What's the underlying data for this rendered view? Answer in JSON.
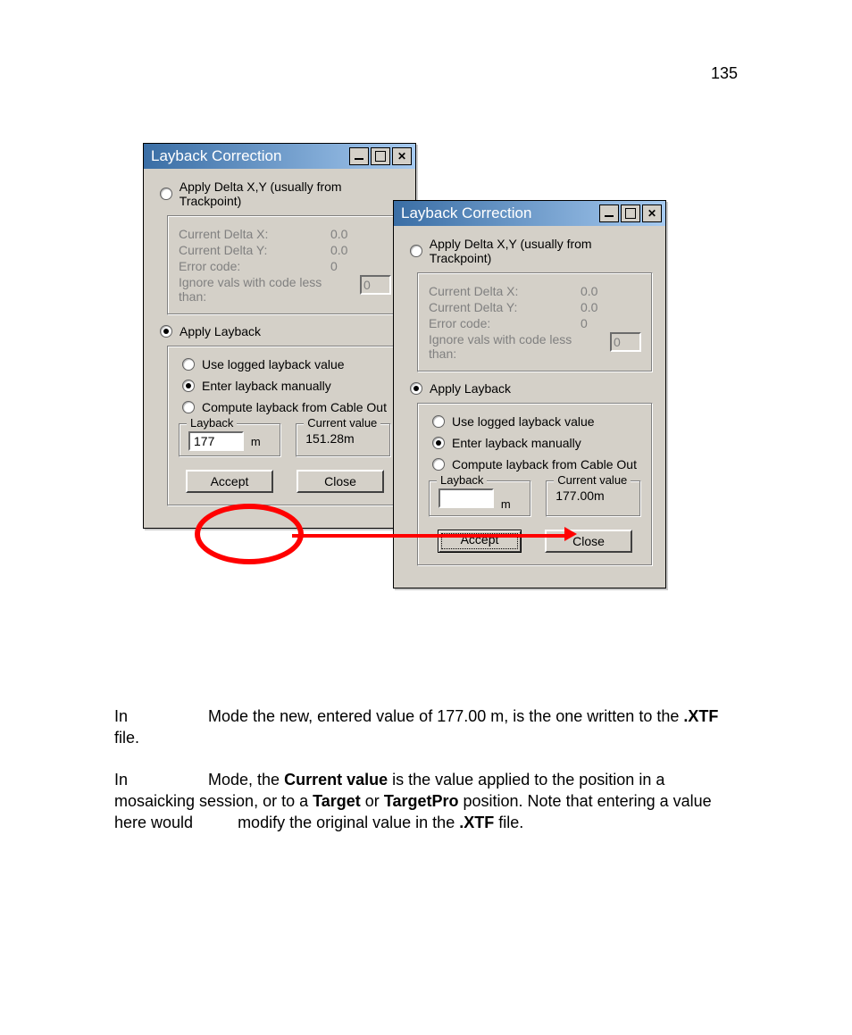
{
  "page_number": "135",
  "dialog_title": "Layback Correction",
  "radio_apply_delta": "Apply Delta X,Y (usually from Trackpoint)",
  "delta_group": {
    "delta_x_label": "Current Delta X:",
    "delta_x_value": "0.0",
    "delta_y_label": "Current Delta Y:",
    "delta_y_value": "0.0",
    "error_label": "Error code:",
    "error_value": "0",
    "ignore_label": "Ignore vals with code less than:",
    "ignore_value": "0"
  },
  "radio_apply_layback": "Apply Layback",
  "layback_options": {
    "use_logged": "Use logged layback value",
    "enter_manually": "Enter layback manually",
    "compute_cable": "Compute layback from Cable Out"
  },
  "layback_fieldset_label": "Layback",
  "current_value_fieldset_label": "Current value",
  "unit": "m",
  "dialog1": {
    "layback_input": "177",
    "current_value": "151.28m"
  },
  "dialog2": {
    "layback_input": "",
    "current_value": "177.00m"
  },
  "buttons": {
    "accept": "Accept",
    "close": "Close"
  },
  "text": {
    "p1a": "In ",
    "p1b": " Mode the new, entered value of 177.00 m, is the one written to the ",
    "p1c": ".XTF",
    "p1d": " file.",
    "p2a": "In ",
    "p2b": " Mode, the ",
    "p2c": "Current value",
    "p2d": " is the value applied to the position in a mosaicking session, or to a ",
    "p2e": "Target",
    "p2f": " or ",
    "p2g": "TargetPro",
    "p2h": " position. Note that entering a value here would ",
    "p2i": " modify the original value in the ",
    "p2j": ".XTF",
    "p2k": " file."
  }
}
